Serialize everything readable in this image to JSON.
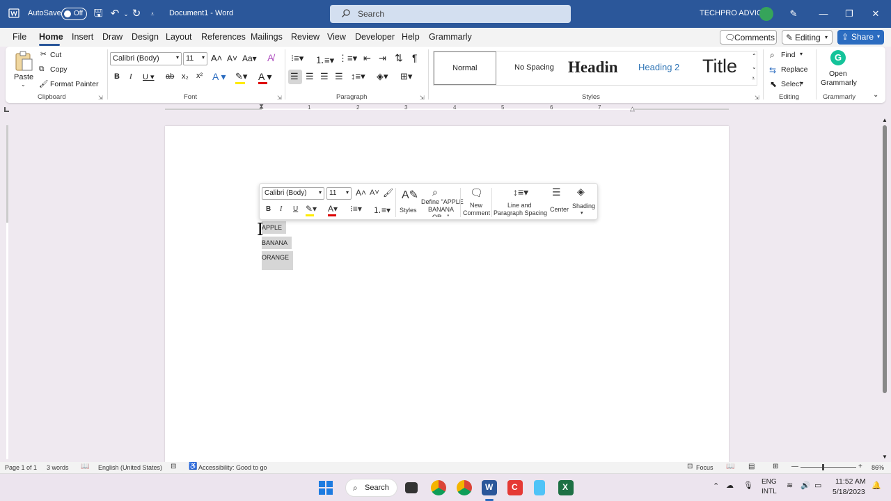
{
  "titlebar": {
    "autosave_label": "AutoSave",
    "autosave_state": "Off",
    "document_title": "Document1 - Word",
    "search_placeholder": "Search",
    "user_name": "TECHPRO ADVICE"
  },
  "menu": {
    "tabs": [
      "File",
      "Home",
      "Insert",
      "Draw",
      "Design",
      "Layout",
      "References",
      "Mailings",
      "Review",
      "View",
      "Developer",
      "Help",
      "Grammarly"
    ],
    "comments_label": "Comments",
    "editing_label": "Editing",
    "share_label": "Share"
  },
  "ribbon": {
    "clipboard": {
      "paste": "Paste",
      "cut": "Cut",
      "copy": "Copy",
      "format_painter": "Format Painter",
      "label": "Clipboard"
    },
    "font": {
      "name": "Calibri (Body)",
      "size": "11",
      "label": "Font"
    },
    "paragraph": {
      "label": "Paragraph"
    },
    "styles": {
      "items": [
        "Normal",
        "No Spacing",
        "Headin",
        "Heading 2",
        "Title"
      ],
      "label": "Styles"
    },
    "editing": {
      "find": "Find",
      "replace": "Replace",
      "select": "Select",
      "label": "Editing"
    },
    "grammarly": {
      "open": "Open",
      "grammarly": "Grammarly",
      "label": "Grammarly"
    }
  },
  "ruler_numbers": [
    "1",
    "2",
    "3",
    "4",
    "5",
    "6",
    "7"
  ],
  "mini_toolbar": {
    "font_name": "Calibri (Body)",
    "font_size": "11",
    "styles": "Styles",
    "define": "Define \"APPLE",
    "define2": "BANANA",
    "define3": "OR...\"",
    "new_comment_1": "New",
    "new_comment_2": "Comment",
    "line_spacing_1": "Line and",
    "line_spacing_2": "Paragraph Spacing",
    "center": "Center",
    "shading": "Shading"
  },
  "document": {
    "lines": [
      "APPLE",
      "BANANA",
      "ORANGE"
    ]
  },
  "statusbar": {
    "page": "Page 1 of 1",
    "words": "3 words",
    "language": "English (United States)",
    "accessibility": "Accessibility: Good to go",
    "focus": "Focus",
    "zoom": "86%"
  },
  "taskbar": {
    "search": "Search",
    "lang_1": "ENG",
    "lang_2": "INTL",
    "time": "11:52 AM",
    "date": "5/18/2023"
  },
  "colors": {
    "word_blue": "#2b579a",
    "share_blue": "#2b6cc0",
    "grammarly_green": "#15c39a"
  }
}
